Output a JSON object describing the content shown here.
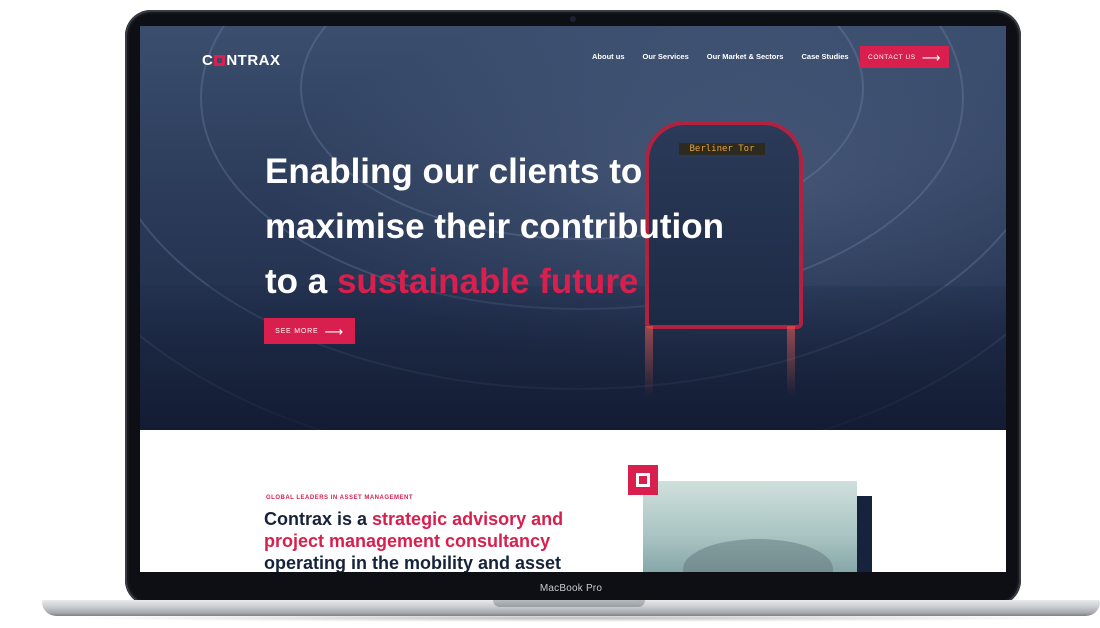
{
  "device": {
    "label": "MacBook Pro"
  },
  "brand": {
    "logo_prefix": "C",
    "logo_suffix": "NTRAX",
    "accent": "#d81f4d",
    "navy": "#16233d"
  },
  "nav": {
    "items": [
      "About us",
      "Our Services",
      "Our Market & Sectors",
      "Case Studies"
    ],
    "contact_label": "CONTACT US"
  },
  "hero": {
    "headline_line1": "Enabling our clients to",
    "headline_line2": "maximise their contribution",
    "headline_line3_plain": "to a ",
    "headline_line3_accent": "sustainable future",
    "cta_label": "SEE MORE",
    "train_sign": "Berliner Tor"
  },
  "intro": {
    "eyebrow": "GLOBAL LEADERS IN ASSET MANAGEMENT",
    "text_plain": "Contrax is a ",
    "text_accent": "strategic advisory and project management consultancy",
    "text_rest": " operating in the mobility and asset"
  },
  "icons": {
    "arrow": "arrow-right-icon",
    "square": "square-logo-icon"
  }
}
